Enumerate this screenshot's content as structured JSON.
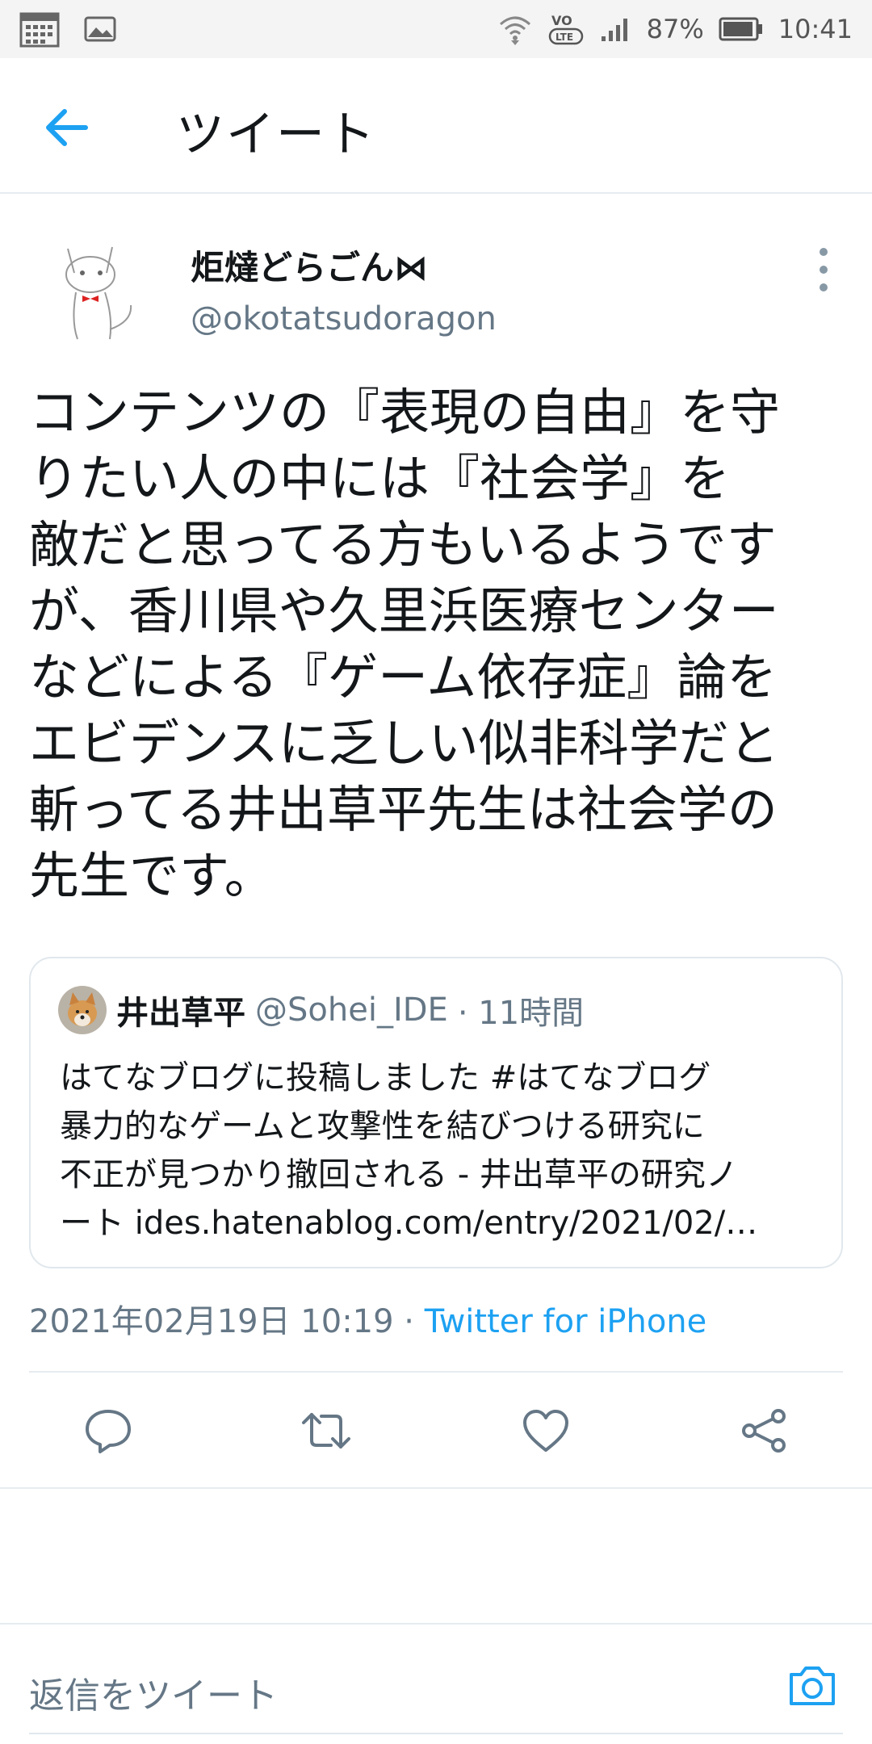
{
  "status_bar": {
    "battery": "87%",
    "time": "10:41",
    "icons": [
      "calendar-icon",
      "image-icon",
      "wifi-icon",
      "volte-icon",
      "signal-icon",
      "battery-icon"
    ]
  },
  "app_bar": {
    "title": "ツイート",
    "back_icon": "arrow-left-icon"
  },
  "tweet": {
    "author_name": "炬燵どらごん⋈",
    "author_handle": "@okotatsudoragon",
    "lines": [
      "コンテンツの『表現の自由』を守",
      "りたい人の中には『社会学』を",
      "敵だと思ってる方もいるようです",
      "が、香川県や久里浜医療センター",
      "などによる『ゲーム依存症』論を",
      "エビデンスに乏しい似非科学だと",
      "斬ってる井出草平先生は社会学の",
      "先生です。"
    ],
    "timestamp": "2021年02月19日 10:19",
    "separator": " · ",
    "source": "Twitter for iPhone"
  },
  "quoted_tweet": {
    "author_name": "井出草平",
    "author_handle": "@Sohei_IDE",
    "time_ago": "· 11時間",
    "lines": [
      "はてなブログに投稿しました #はてなブログ",
      "暴力的なゲームと攻撃性を結びつける研究に",
      "不正が見つかり撤回される - 井出草平の研究ノ",
      "ート ides.hatenablog.com/entry/2021/02/…"
    ]
  },
  "actions": [
    "reply-icon",
    "retweet-icon",
    "like-icon",
    "share-icon"
  ],
  "reply_bar": {
    "placeholder": "返信をツイート",
    "icon": "camera-icon"
  },
  "colors": {
    "accent": "#1da1f2",
    "text": "#14171a",
    "secondary": "#657786",
    "border": "#e6ecf0",
    "status_bg": "#f4f4f4"
  }
}
